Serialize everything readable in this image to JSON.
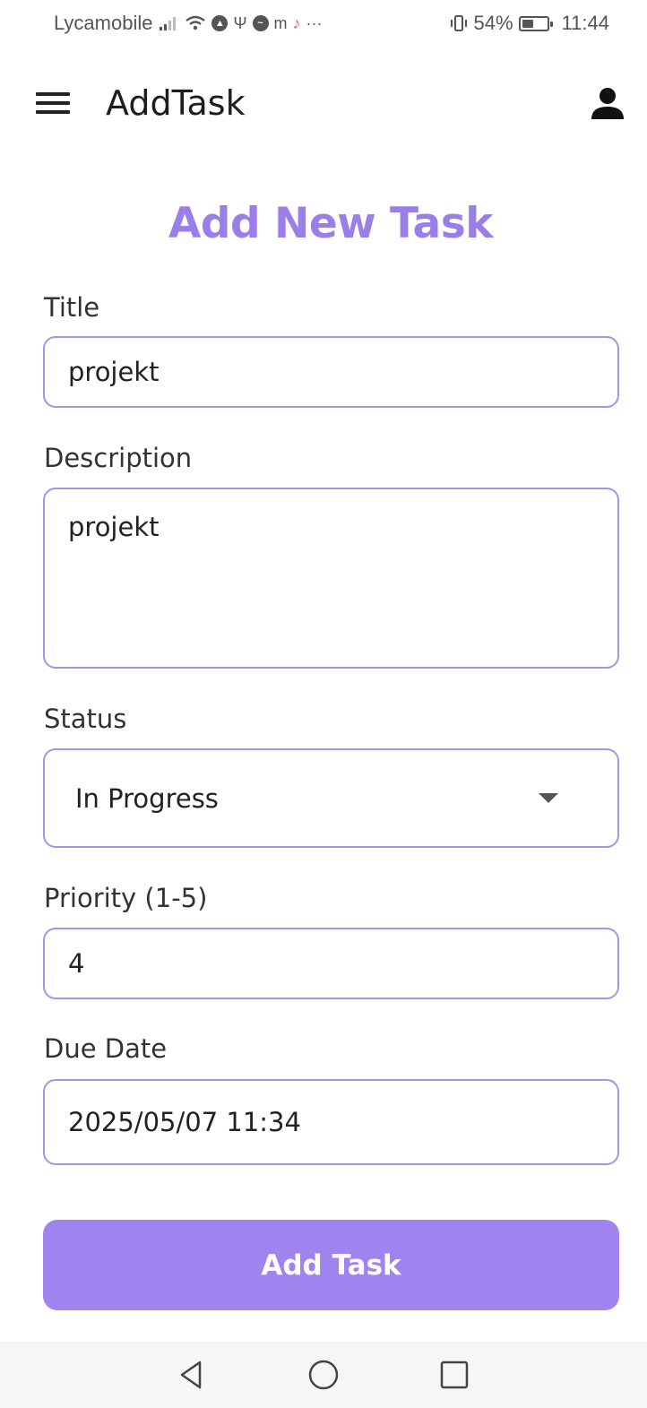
{
  "status_bar": {
    "carrier": "Lycamobile",
    "battery": "54%",
    "battery_level": 0.54,
    "time": "11:44",
    "icons": [
      "signal-icon",
      "wifi-icon",
      "navigation-icon",
      "usb-icon",
      "messenger-icon",
      "mcdonalds-icon",
      "tiktok-icon",
      "more-icon",
      "vibrate-icon",
      "battery-icon"
    ]
  },
  "app_bar": {
    "title": "AddTask",
    "icons": [
      "menu-icon",
      "account-icon"
    ]
  },
  "form": {
    "heading": "Add New Task",
    "title_label": "Title",
    "title_value": "projekt",
    "description_label": "Description",
    "description_value": "projekt",
    "status_label": "Status",
    "status_value": "In Progress",
    "priority_label": "Priority (1-5)",
    "priority_value": "4",
    "due_date_label": "Due Date",
    "due_date_value": "2025/05/07 11:34",
    "submit_label": "Add Task"
  },
  "nav_bar": {
    "icons": [
      "back-icon",
      "home-icon",
      "recents-icon"
    ]
  },
  "colors": {
    "accent": "#9b7fe8",
    "button": "#9f83ef",
    "field_border": "#a991e6"
  }
}
